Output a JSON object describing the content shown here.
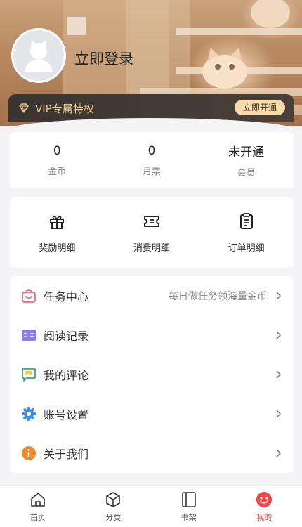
{
  "header": {
    "avatar_icon": "user-avatar-placeholder",
    "login_label": "立即登录"
  },
  "vip": {
    "icon": "diamond-icon",
    "label": "VIP专属特权",
    "button_label": "立即开通",
    "text_color": "#f0cf91",
    "button_color": "#f6dcaa"
  },
  "stats": [
    {
      "value": "0",
      "label": "金币"
    },
    {
      "value": "0",
      "label": "月票"
    },
    {
      "value": "未开通",
      "label": "会员"
    }
  ],
  "details": [
    {
      "icon": "gift-icon",
      "label": "奖励明细"
    },
    {
      "icon": "ticket-icon",
      "label": "消费明细"
    },
    {
      "icon": "clipboard-icon",
      "label": "订单明细"
    }
  ],
  "menu": [
    {
      "icon": "task-bag-icon",
      "label": "任务中心",
      "hint": "每日做任务领海量金币"
    },
    {
      "icon": "reading-history-icon",
      "label": "阅读记录",
      "hint": ""
    },
    {
      "icon": "comment-icon",
      "label": "我的评论",
      "hint": ""
    },
    {
      "icon": "gear-icon",
      "label": "账号设置",
      "hint": ""
    },
    {
      "icon": "info-icon",
      "label": "关于我们",
      "hint": ""
    }
  ],
  "tabs": [
    {
      "icon": "home-icon",
      "label": "首页",
      "active": false
    },
    {
      "icon": "category-cube-icon",
      "label": "分类",
      "active": false
    },
    {
      "icon": "bookshelf-icon",
      "label": "书架",
      "active": false
    },
    {
      "icon": "smile-icon",
      "label": "我的",
      "active": true
    }
  ],
  "colors": {
    "accent_red": "#f04848",
    "background": "#f4f4f6"
  }
}
